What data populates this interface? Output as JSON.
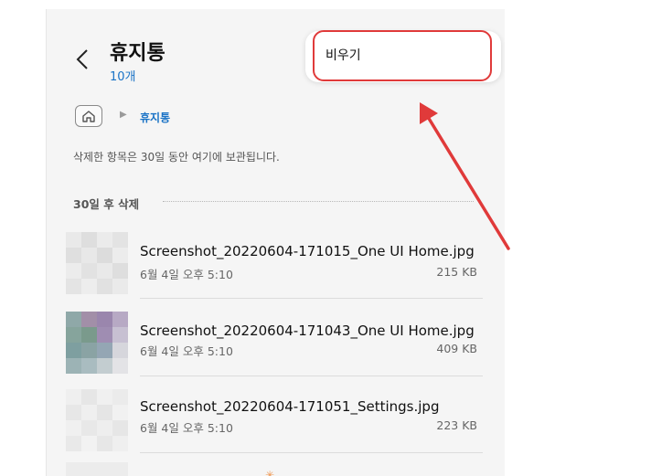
{
  "header": {
    "title": "휴지통",
    "count": "10개"
  },
  "menu": {
    "empty_label": "비우기"
  },
  "breadcrumb": {
    "current": "휴지통"
  },
  "notice": "삭제한 항목은 30일 동안 여기에 보관됩니다.",
  "section": {
    "title": "30일 후 삭제"
  },
  "files": [
    {
      "name": "Screenshot_20220604-171015_One UI Home.jpg",
      "date": "6월 4일 오후 5:10",
      "size": "215 KB"
    },
    {
      "name": "Screenshot_20220604-171043_One UI Home.jpg",
      "date": "6월 4일 오후 5:10",
      "size": "409 KB"
    },
    {
      "name": "Screenshot_20220604-171051_Settings.jpg",
      "date": "6월 4일 오후 5:10",
      "size": "223 KB"
    }
  ],
  "colors": {
    "accent": "#1a73c6",
    "annotation": "#e03a3a"
  },
  "icons": {
    "back": "chevron-left-icon",
    "home": "home-icon",
    "breadcrumb_separator": "triangle-right-icon"
  }
}
